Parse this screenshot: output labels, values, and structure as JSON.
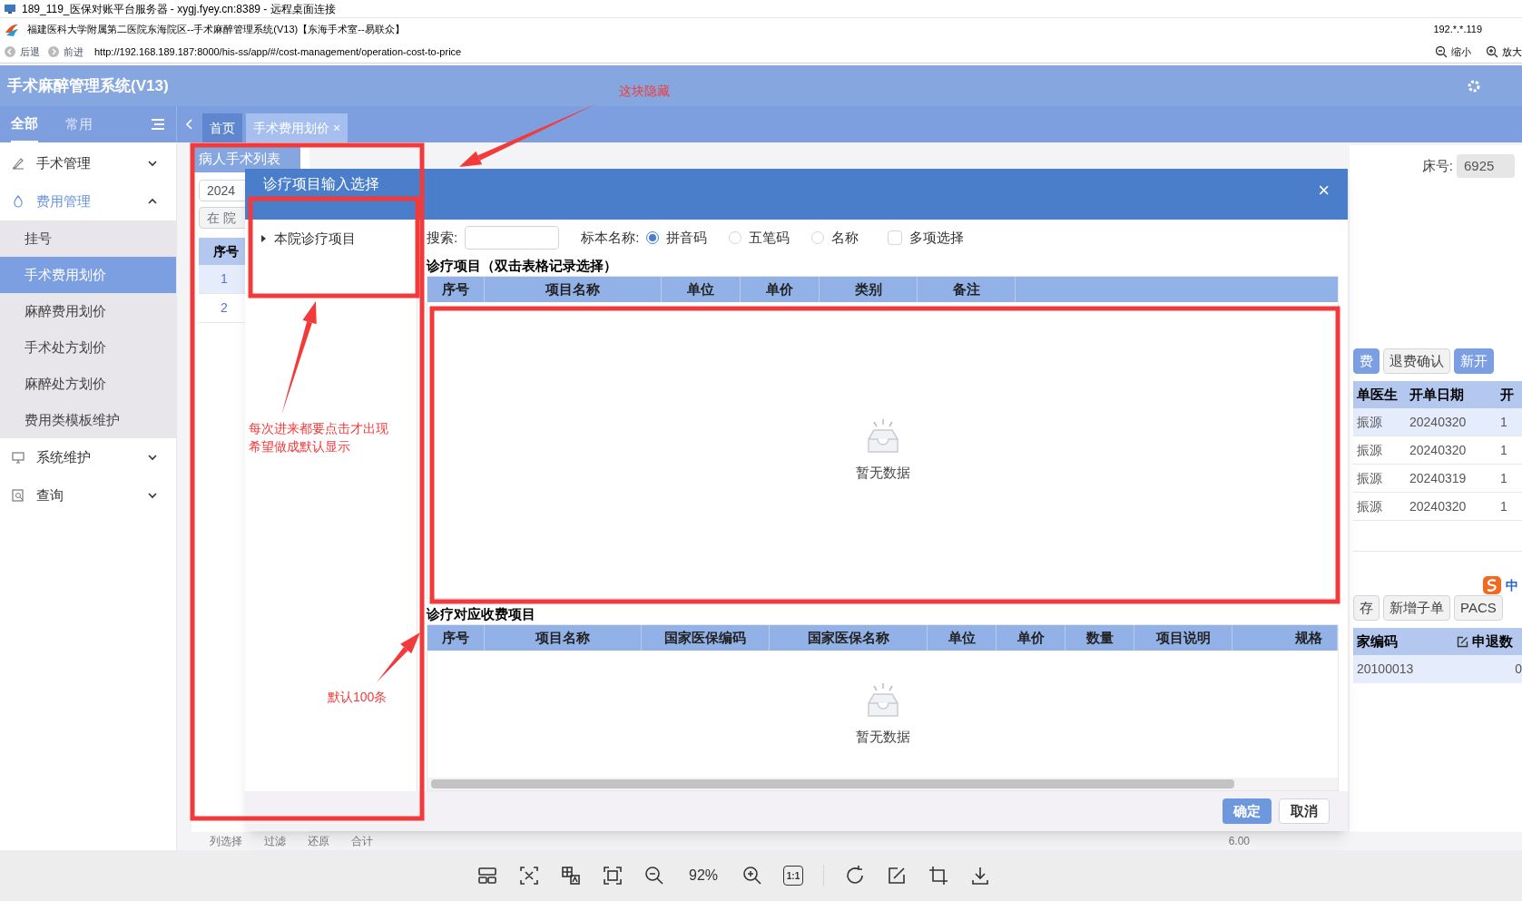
{
  "remote_window": {
    "title": "189_119_医保对账平台服务器 - xygj.fyey.cn:8389 - 远程桌面连接"
  },
  "browser": {
    "page_title": "福建医科大学附属第二医院东海院区--手术麻醉管理系统(V13)【东海手术室--易联众】",
    "ip": "192.*.*.119",
    "back": "后退",
    "forward": "前进",
    "url": "http://192.168.189.187:8000/his-ss/app/#/cost-management/operation-cost-to-price",
    "zoom_out": "缩小",
    "zoom_in": "放大"
  },
  "app": {
    "title": "手术麻醉管理系统(V13)"
  },
  "sidebar": {
    "tabs": [
      {
        "label": "全部",
        "selected": true
      },
      {
        "label": "常用",
        "selected": false
      }
    ],
    "items": [
      {
        "label": "手术管理",
        "expanded": false
      },
      {
        "label": "费用管理",
        "expanded": true,
        "children": [
          {
            "label": "挂号",
            "selected": false
          },
          {
            "label": "手术费用划价",
            "selected": true
          },
          {
            "label": "麻醉费用划价",
            "selected": false
          },
          {
            "label": "手术处方划价",
            "selected": false
          },
          {
            "label": "麻醉处方划价",
            "selected": false
          },
          {
            "label": "费用类模板维护",
            "selected": false
          }
        ]
      },
      {
        "label": "系统维护",
        "expanded": false
      },
      {
        "label": "查询",
        "expanded": false
      }
    ]
  },
  "page_tabs": [
    {
      "label": "首页",
      "selected": false
    },
    {
      "label": "手术费用划价",
      "selected": true,
      "close": "×"
    }
  ],
  "background": {
    "left": {
      "tab": "病人手术列表",
      "date": "2024",
      "status_button": "在 院",
      "column": "序号",
      "rows": [
        {
          "cells": [
            "1"
          ],
          "selected": true
        },
        {
          "cells": [
            "2"
          ],
          "selected": false
        }
      ]
    },
    "right": {
      "bed_label": "床号:",
      "bed_value": "6925",
      "buttons": [
        {
          "label": "费",
          "primary": true
        },
        {
          "label": "退费确认",
          "primary": false
        },
        {
          "label": "新开",
          "primary": true
        }
      ],
      "orders_columns": [
        "单医生",
        "开单日期",
        "开"
      ],
      "orders_rows": [
        {
          "cells": [
            "振源",
            "20240320",
            "1"
          ],
          "selected": true
        },
        {
          "cells": [
            "振源",
            "20240320",
            "1"
          ],
          "selected": false
        },
        {
          "cells": [
            "振源",
            "20240319",
            "1"
          ],
          "selected": false
        },
        {
          "cells": [
            "振源",
            "20240320",
            "1"
          ],
          "selected": false
        }
      ],
      "buttons2": [
        {
          "label": "存",
          "primary": false
        },
        {
          "label": "新增子单",
          "primary": false
        },
        {
          "label": "PACS",
          "primary": false
        }
      ],
      "items_columns": [
        "家编码",
        "申退数"
      ],
      "items_rows": [
        {
          "cells": [
            "20100013",
            "0"
          ],
          "selected": true
        }
      ]
    },
    "footer": {
      "buttons": [
        "列选择",
        "过滤",
        "还原"
      ],
      "total_label": "合计",
      "total": "6.00"
    },
    "ime": {
      "mode": "中"
    }
  },
  "modal": {
    "title": "诊疗项目输入选择",
    "close": "×",
    "tree": [
      {
        "label": "本院诊疗项目",
        "expanded": false
      }
    ],
    "search_label": "搜索:",
    "name_type": {
      "label": "标本名称:",
      "options": [
        {
          "label": "拼音码",
          "selected": true
        },
        {
          "label": "五笔码",
          "selected": false
        },
        {
          "label": "名称",
          "selected": false
        }
      ]
    },
    "multi_select": {
      "label": "多项选择",
      "checked": false
    },
    "items_table": {
      "title": "诊疗项目（双击表格记录选择）",
      "columns": [
        "序号",
        "项目名称",
        "单位",
        "单价",
        "类别",
        "备注"
      ],
      "empty_text": "暂无数据"
    },
    "fees_table": {
      "title": "诊疗对应收费项目",
      "columns": [
        "序号",
        "项目名称",
        "国家医保编码",
        "国家医保名称",
        "单位",
        "单价",
        "数量",
        "项目说明",
        "规格"
      ],
      "empty_text": "暂无数据"
    },
    "buttons": [
      {
        "label": "确定",
        "primary": true
      },
      {
        "label": "取消",
        "primary": false
      }
    ]
  },
  "annotations": [
    "这块隐藏",
    "每次进来都要点击才出现希望做成默认显示",
    "默认100条"
  ],
  "viewer_toolbar": {
    "zoom": "92%",
    "actual_size": "1:1"
  }
}
